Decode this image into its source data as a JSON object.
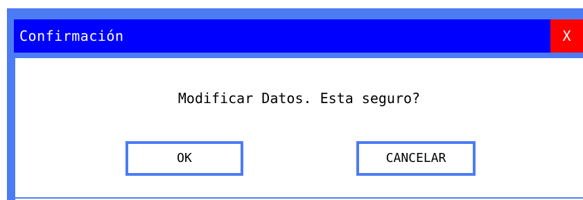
{
  "dialog": {
    "title": "Confirmación",
    "close_label": "X",
    "message": "Modificar Datos. Esta seguro?",
    "ok_label": "OK",
    "cancel_label": "CANCELAR"
  },
  "colors": {
    "border_accent": "#4c7cf4",
    "title_bar": "#0000ff",
    "close_button": "#ff0000",
    "background": "#ffffff",
    "text": "#000000"
  }
}
